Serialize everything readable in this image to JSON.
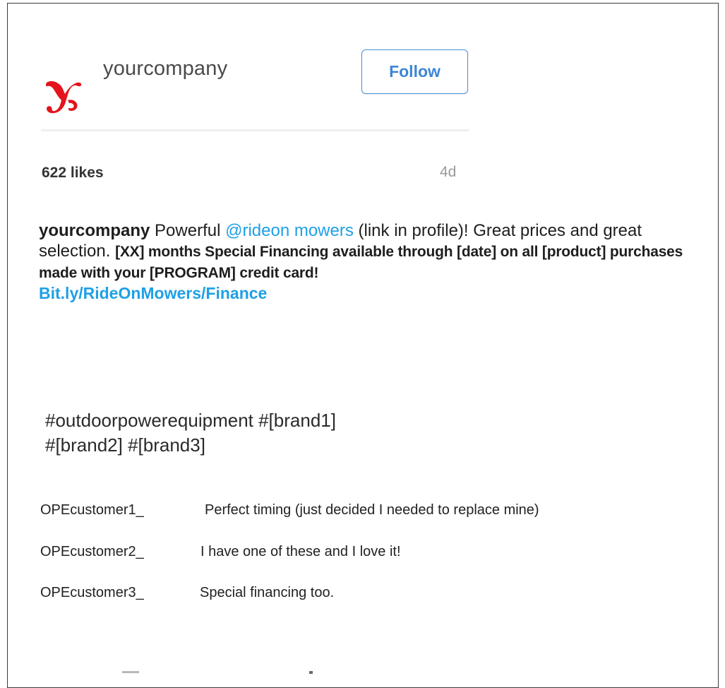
{
  "post": {
    "header": {
      "logo_icon": "red-y-logo-icon",
      "username": "yourcompany",
      "follow_label": "Follow"
    },
    "stats": {
      "likes": "622 likes",
      "age": "4d"
    },
    "caption": {
      "author": "yourcompany",
      "text_before_mention": " Powerful ",
      "mention": "@rideon mowers",
      "text_after_mention": " (link in profile)! Great prices and great selection. ",
      "offer": "[XX] months Special Financing available through [date] on all [product] purchases made with your [PROGRAM] credit card!",
      "link": "Bit.ly/RideOnMowers/Finance"
    },
    "hashtags": {
      "line1": "#outdoorpowerequipment  #[brand1]",
      "line2": "#[brand2]  #[brand3]"
    },
    "comments": [
      {
        "user": "OPEcustomer1_",
        "text": "Perfect timing (just decided I needed to replace mine)"
      },
      {
        "user": "OPEcustomer2_",
        "text": "I have one of these and I love it!"
      },
      {
        "user": "OPEcustomer3_",
        "text": "Special financing too."
      }
    ]
  },
  "colors": {
    "link_blue": "#1fa0e6",
    "follow_blue": "#3d86d6",
    "logo_red": "#e3141c"
  }
}
